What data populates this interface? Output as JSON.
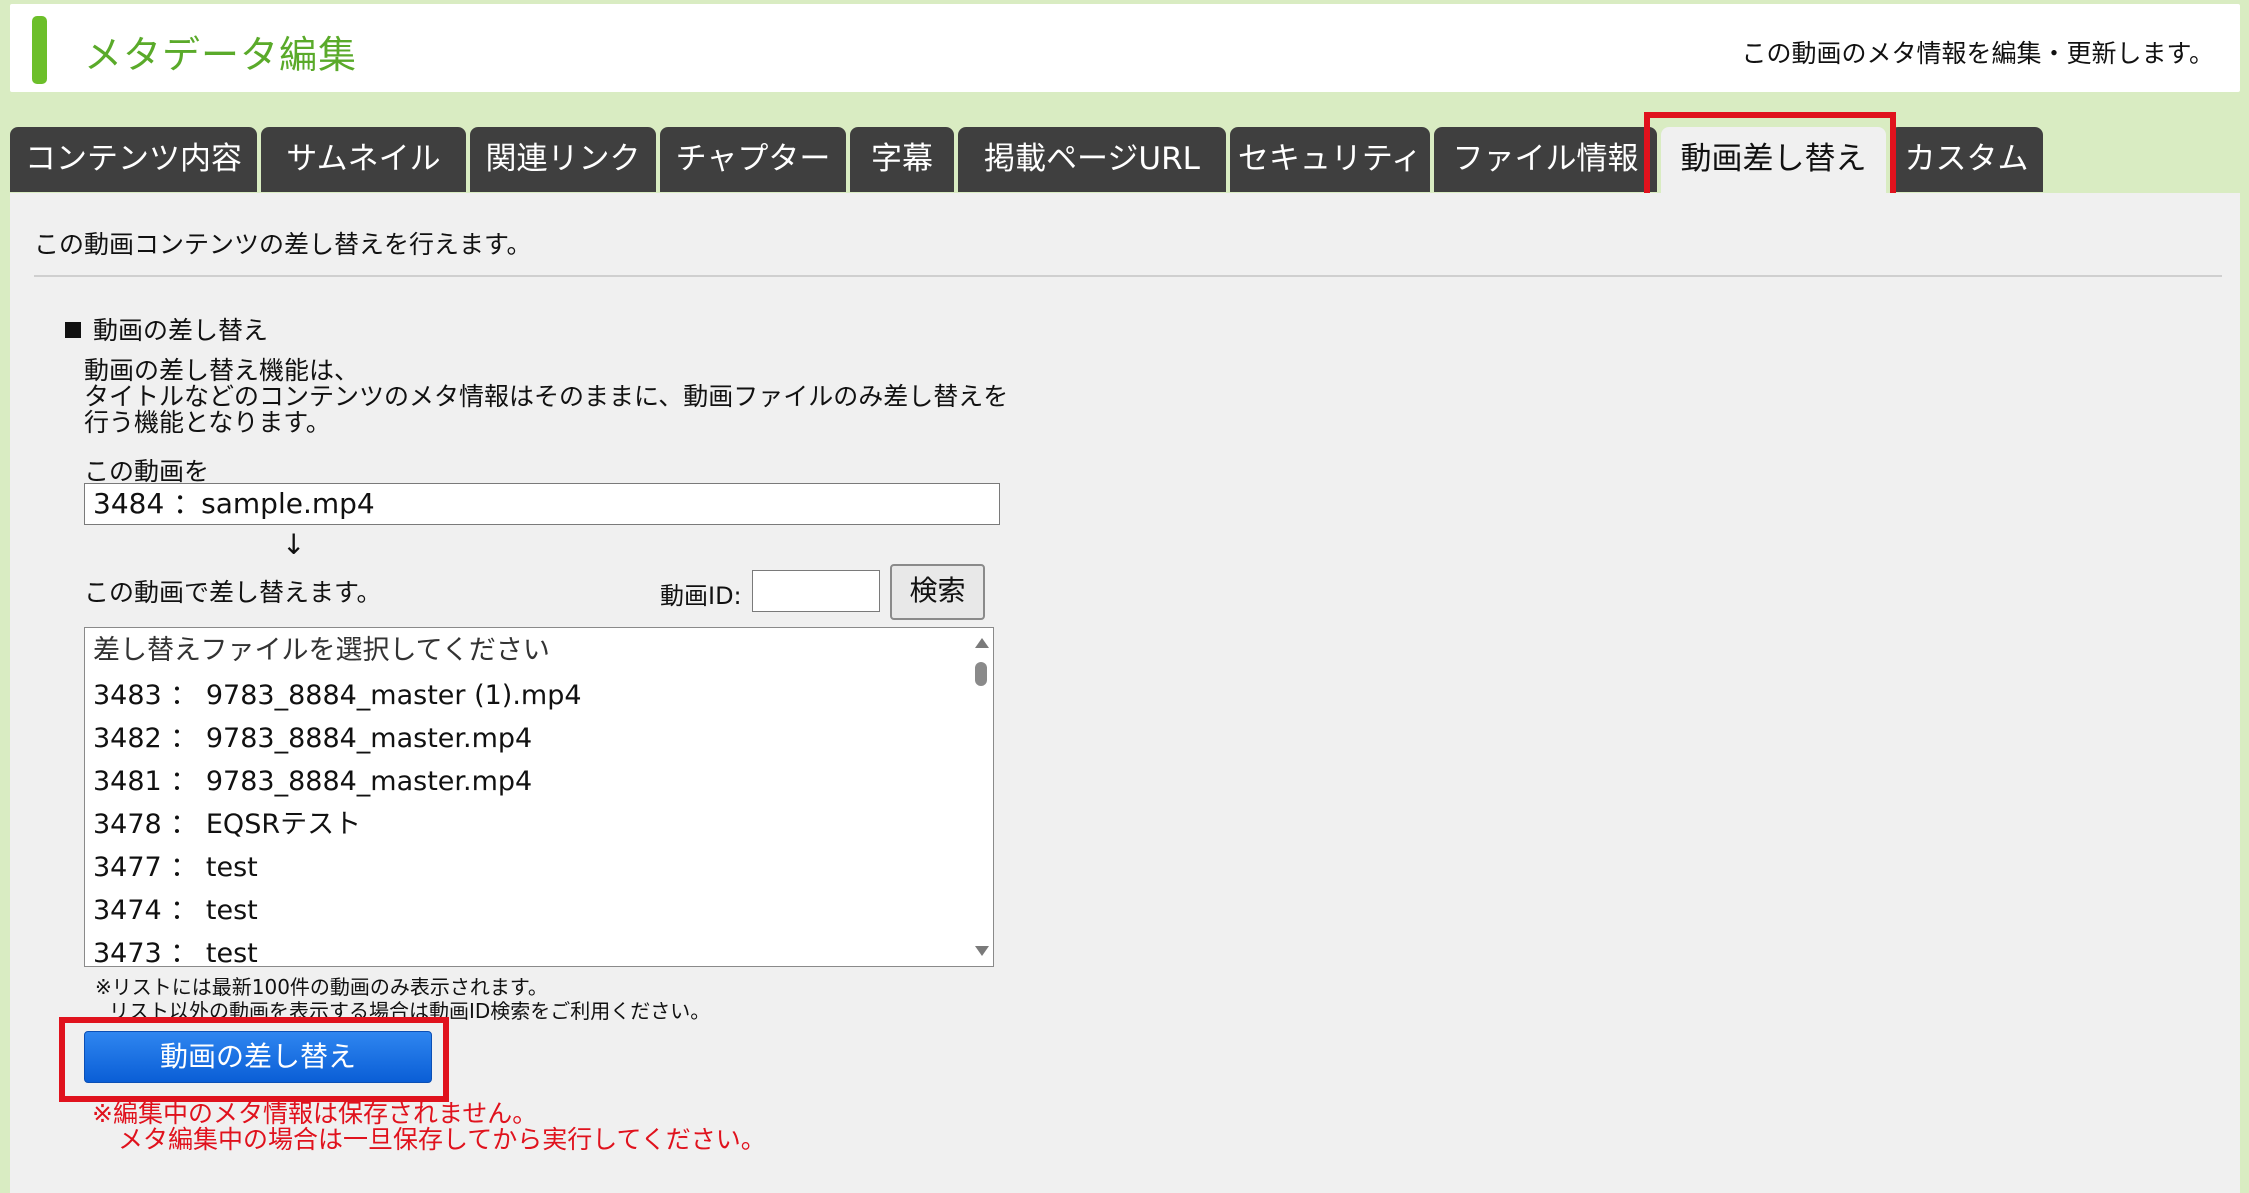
{
  "header": {
    "title": "メタデータ編集",
    "description": "この動画のメタ情報を編集・更新します。",
    "accent_color": "#6cbf2a"
  },
  "tabs": [
    {
      "label": "コンテンツ内容",
      "active": false
    },
    {
      "label": "サムネイル",
      "active": false
    },
    {
      "label": "関連リンク",
      "active": false
    },
    {
      "label": "チャプター",
      "active": false
    },
    {
      "label": "字幕",
      "active": false
    },
    {
      "label": "掲載ページURL",
      "active": false
    },
    {
      "label": "セキュリティ",
      "active": false
    },
    {
      "label": "ファイル情報",
      "active": false
    },
    {
      "label": "動画差し替え",
      "active": true
    },
    {
      "label": "カスタム",
      "active": false
    }
  ],
  "content": {
    "intro": "この動画コンテンツの差し替えを行えます。",
    "section_title": "動画の差し替え",
    "description_lines": [
      "動画の差し替え機能は、",
      "タイトルなどのコンテンツのメタ情報はそのままに、動画ファイルのみ差し替えを",
      "行う機能となります。"
    ],
    "current_label": "この動画を",
    "current_value": "3484 ：sample.mp4",
    "arrow": "↓",
    "replace_label": "この動画で差し替えます。",
    "id_label": "動画ID:",
    "id_value": "",
    "search_label": "検索",
    "list_placeholder": "差し替えファイルを選択してください",
    "list_items": [
      "3483 ： 9783_8884_master (1).mp4",
      "3482 ： 9783_8884_master.mp4",
      "3481 ： 9783_8884_master.mp4",
      "3478 ： EQSRテスト",
      "3477 ： test",
      "3474 ： test",
      "3473 ： test"
    ],
    "note_lines": [
      "※リストには最新100件の動画のみ表示されます。",
      "リスト以外の動画を表示する場合は動画ID検索をご利用ください。"
    ],
    "action_label": "動画の差し替え",
    "warning_lines": [
      "※編集中のメタ情報は保存されません。",
      "メタ編集中の場合は一旦保存してから実行してください。"
    ]
  },
  "colors": {
    "background": "#d9ecc2",
    "tab_dark": "#3f3f3f",
    "highlight_red": "#e0121d",
    "button_blue": "#1a6fe3"
  }
}
